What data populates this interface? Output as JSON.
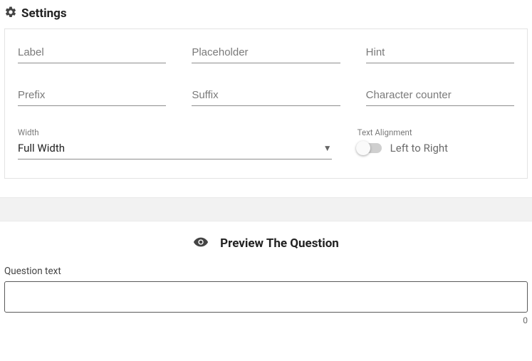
{
  "header": {
    "title": "Settings"
  },
  "fields": {
    "label": {
      "placeholder": "Label",
      "value": ""
    },
    "placeholder": {
      "placeholder": "Placeholder",
      "value": ""
    },
    "hint": {
      "placeholder": "Hint",
      "value": ""
    },
    "prefix": {
      "placeholder": "Prefix",
      "value": ""
    },
    "suffix": {
      "placeholder": "Suffix",
      "value": ""
    },
    "charcounter": {
      "placeholder": "Character counter",
      "value": ""
    }
  },
  "width": {
    "label": "Width",
    "value": "Full Width"
  },
  "align": {
    "label": "Text Alignment",
    "value": "Left to Right",
    "on": false
  },
  "preview": {
    "heading": "Preview The Question",
    "question_label": "Question text",
    "question_value": "",
    "counter": "0"
  }
}
